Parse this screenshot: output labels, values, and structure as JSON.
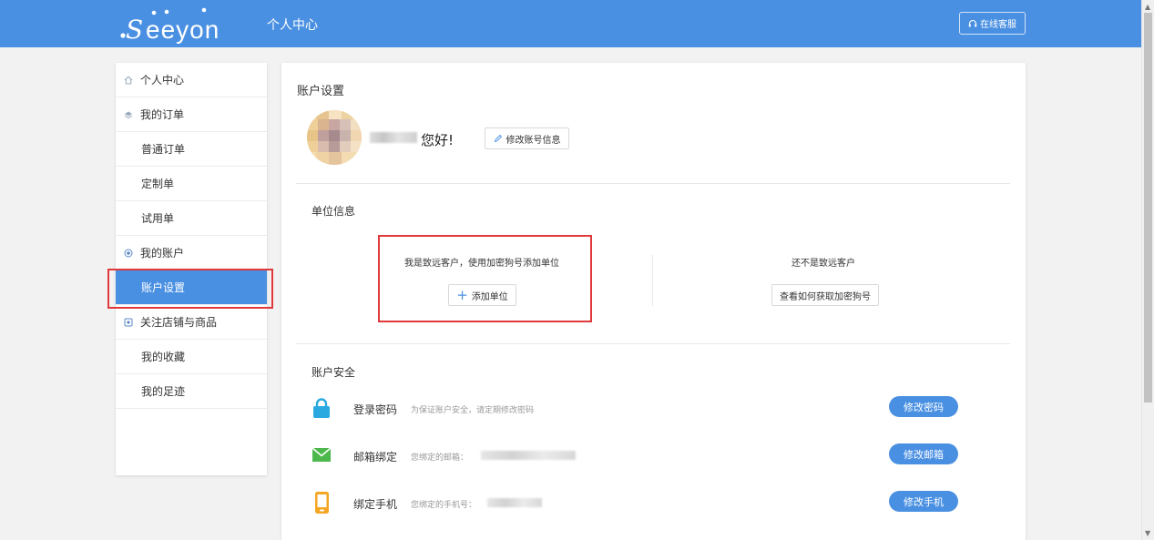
{
  "header": {
    "logo_text": ".Seeyon",
    "title": "个人中心",
    "support_label": "在线客服"
  },
  "sidebar": {
    "items": [
      {
        "label": "个人中心",
        "type": "group",
        "icon": "home-icon"
      },
      {
        "label": "我的订单",
        "type": "group",
        "icon": "order-icon"
      },
      {
        "label": "普通订单",
        "type": "sub"
      },
      {
        "label": "定制单",
        "type": "sub"
      },
      {
        "label": "试用单",
        "type": "sub"
      },
      {
        "label": "我的账户",
        "type": "group",
        "icon": "account-icon"
      },
      {
        "label": "账户设置",
        "type": "sub",
        "active": true
      },
      {
        "label": "关注店铺与商品",
        "type": "group",
        "icon": "follow-icon"
      },
      {
        "label": "我的收藏",
        "type": "sub"
      },
      {
        "label": "我的足迹",
        "type": "sub"
      }
    ]
  },
  "main": {
    "title": "账户设置",
    "greeting": "您好!",
    "edit_account_label": "修改账号信息",
    "unit_info": {
      "title": "单位信息",
      "left_text": "我是致远客户，使用加密狗号添加单位",
      "add_button_label": "添加单位",
      "right_text": "还不是致远客户",
      "howto_button_label": "查看如何获取加密狗号"
    },
    "security": {
      "title": "账户安全",
      "rows": [
        {
          "label": "登录密码",
          "desc": "为保证账户安全，请定期修改密码",
          "button": "修改密码",
          "icon": "lock-icon"
        },
        {
          "label": "邮箱绑定",
          "desc": "您绑定的邮箱：",
          "button": "修改邮箱",
          "icon": "envelope-icon"
        },
        {
          "label": "绑定手机",
          "desc": "您绑定的手机号：",
          "button": "修改手机",
          "icon": "phone-icon"
        }
      ]
    }
  },
  "colors": {
    "brand": "#4a90e2",
    "highlight": "#e0393c",
    "lock": "#29a9e0",
    "envelope": "#4cb84c",
    "phone": "#f5a623"
  }
}
